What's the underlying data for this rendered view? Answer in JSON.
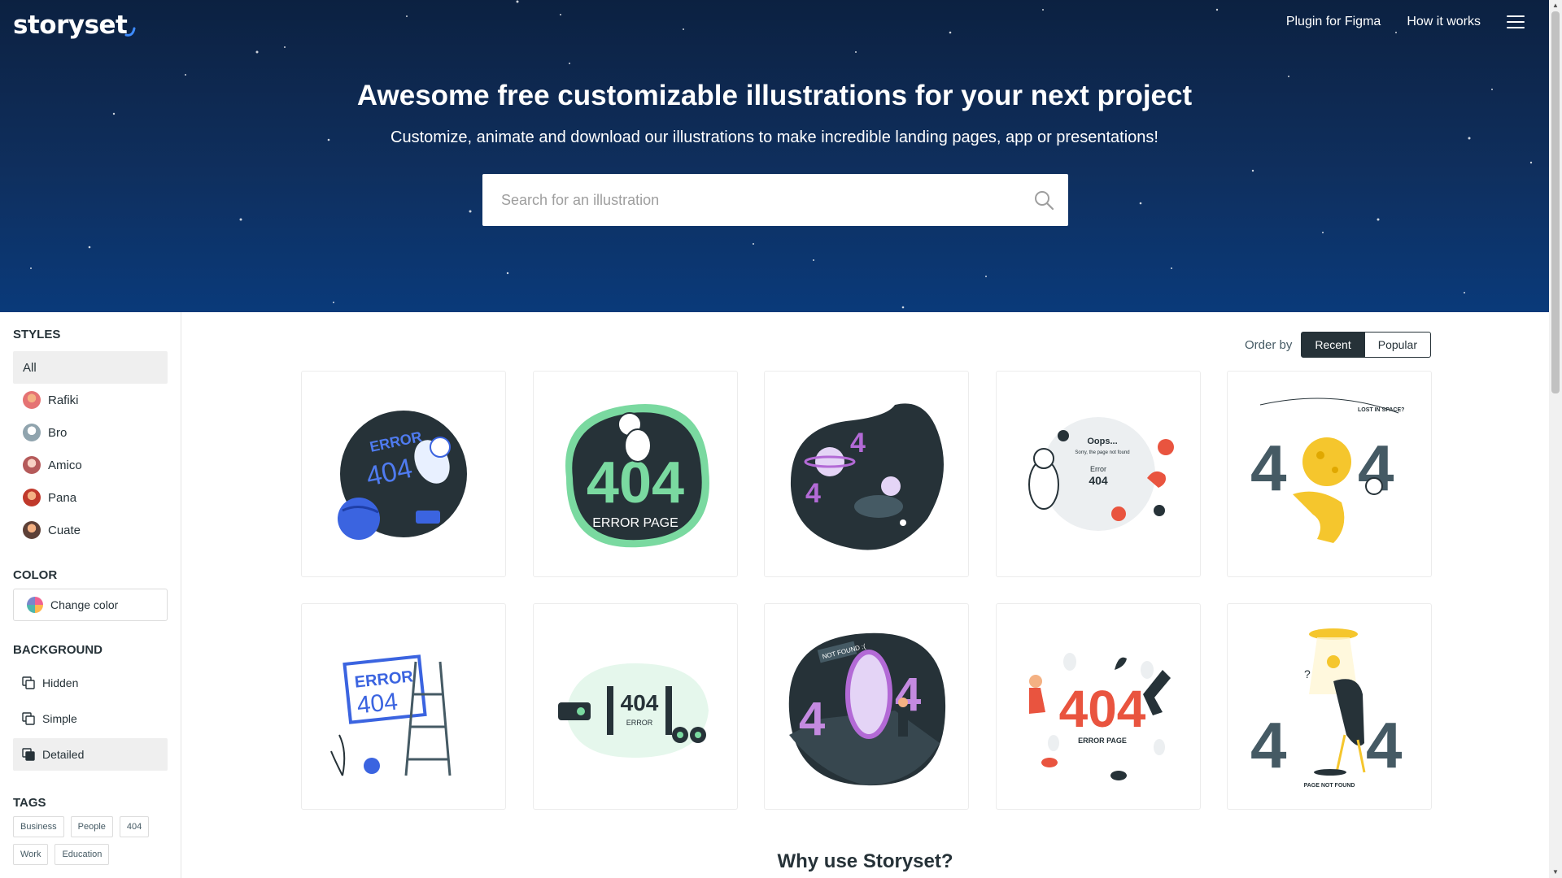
{
  "header": {
    "logo_text": "storyset",
    "nav": [
      "Plugin for Figma",
      "How it works"
    ]
  },
  "hero": {
    "title": "Awesome free customizable illustrations for your next project",
    "subtitle": "Customize, animate and download our illustrations to make incredible landing pages, app or presentations!",
    "search_placeholder": "Search for an illustration"
  },
  "sidebar": {
    "styles_heading": "STYLES",
    "styles": [
      {
        "label": "All"
      },
      {
        "label": "Rafiki"
      },
      {
        "label": "Bro"
      },
      {
        "label": "Amico"
      },
      {
        "label": "Pana"
      },
      {
        "label": "Cuate"
      }
    ],
    "color_heading": "COLOR",
    "color_button": "Change color",
    "background_heading": "BACKGROUND",
    "backgrounds": [
      "Hidden",
      "Simple",
      "Detailed"
    ],
    "tags_heading": "TAGS",
    "tags": [
      "Business",
      "People",
      "404",
      "Work",
      "Education"
    ]
  },
  "main": {
    "order_label": "Order by",
    "order_options": [
      "Recent",
      "Popular"
    ],
    "illustrations": [
      {
        "text": [
          "ERROR",
          "404"
        ]
      },
      {
        "text": [
          "404",
          "ERROR PAGE"
        ]
      },
      {
        "text": [
          "4",
          "4"
        ]
      },
      {
        "text": [
          "Oops...",
          "Sorry, the page not found",
          "Error",
          "404"
        ]
      },
      {
        "text": [
          "LOST IN SPACE?",
          "4",
          "4"
        ]
      },
      {
        "text": [
          "ERROR",
          "404"
        ]
      },
      {
        "text": [
          "404",
          "ERROR"
        ]
      },
      {
        "text": [
          "NOT FOUND :(",
          "4",
          "4"
        ]
      },
      {
        "text": [
          "404",
          "ERROR PAGE"
        ]
      },
      {
        "text": [
          "?",
          "4",
          "4",
          "PAGE NOT FOUND"
        ]
      }
    ],
    "section_title": "Why use Storyset?"
  },
  "colors": {
    "hero_bg": "#0f2f5e",
    "green_accent": "#7ad9a0",
    "purple_accent": "#b36ad6",
    "yellow_accent": "#f5c62d",
    "red_accent": "#e9543f",
    "blue_accent": "#3b64e0"
  }
}
